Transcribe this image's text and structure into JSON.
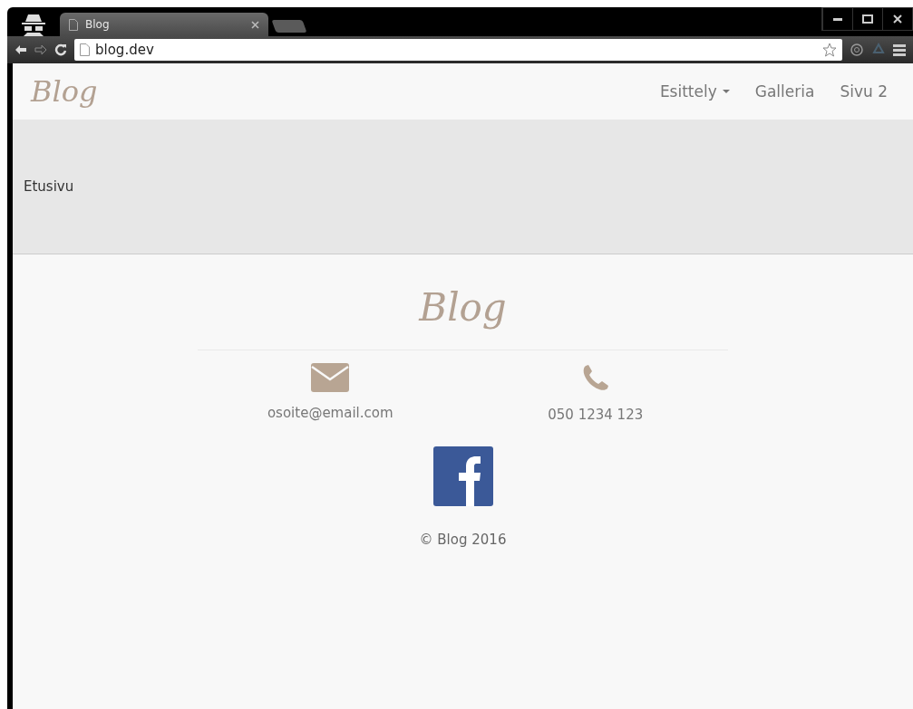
{
  "browser": {
    "tab_title": "Blog",
    "address": "blog.dev"
  },
  "navbar": {
    "brand": "Blog",
    "items": [
      {
        "label": "Esittely",
        "kind": "dropdown"
      },
      {
        "label": "Galleria",
        "kind": "link"
      },
      {
        "label": "Sivu 2",
        "kind": "link"
      }
    ]
  },
  "header": {
    "text": "Etusivu"
  },
  "footer": {
    "brand": "Blog",
    "email": "osoite@email.com",
    "phone": "050 1234 123",
    "copyright": "© Blog 2016"
  }
}
